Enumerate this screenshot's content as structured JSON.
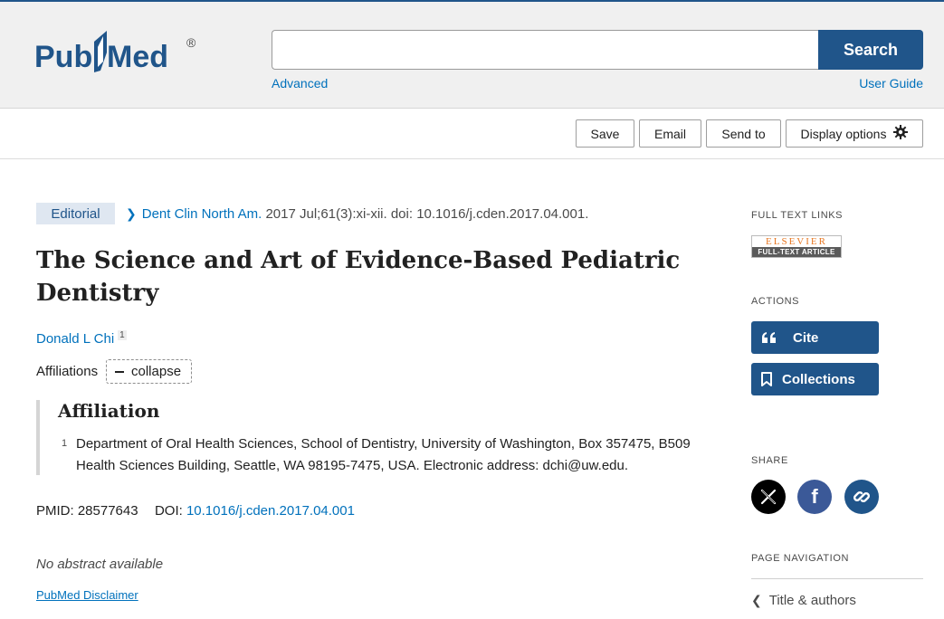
{
  "header": {
    "logo_text": "PubMed",
    "logo_registered": "®",
    "search_value": "",
    "search_button": "Search",
    "advanced_link": "Advanced",
    "user_guide_link": "User Guide",
    "brand_color": "#20558a"
  },
  "toolbar": {
    "save": "Save",
    "email": "Email",
    "send_to": "Send to",
    "display_options": "Display options",
    "display_icon": "gear-icon"
  },
  "article": {
    "type_badge": "Editorial",
    "journal": "Dent Clin North Am.",
    "citation": "2017 Jul;61(3):xi-xii. doi: 10.1016/j.cden.2017.04.001.",
    "title": "The Science and Art of Evidence-Based Pediatric Dentistry",
    "author": "Donald L Chi",
    "author_sup": "1",
    "affiliations_label": "Affiliations",
    "collapse_label": "collapse",
    "affiliation_heading": "Affiliation",
    "affiliation_number": "1",
    "affiliation_text": "Department of Oral Health Sciences, School of Dentistry, University of Washington, Box 357475, B509 Health Sciences Building, Seattle, WA 98195-7475, USA. Electronic address: dchi@uw.edu.",
    "pmid_label": "PMID:",
    "pmid_value": "28577643",
    "doi_label": "DOI:",
    "doi_value": "10.1016/j.cden.2017.04.001",
    "no_abstract": "No abstract available",
    "disclaimer": "PubMed Disclaimer"
  },
  "sidebar": {
    "full_text_heading": "FULL TEXT LINKS",
    "elsevier_top": "ELSEVIER",
    "elsevier_bottom": "FULL-TEXT ARTICLE",
    "actions_heading": "ACTIONS",
    "cite_label": "Cite",
    "collections_label": "Collections",
    "share_heading": "SHARE",
    "share_icons": [
      "x-icon",
      "facebook-icon",
      "link-icon"
    ],
    "page_nav_heading": "PAGE NAVIGATION",
    "nav_item": "Title & authors"
  }
}
